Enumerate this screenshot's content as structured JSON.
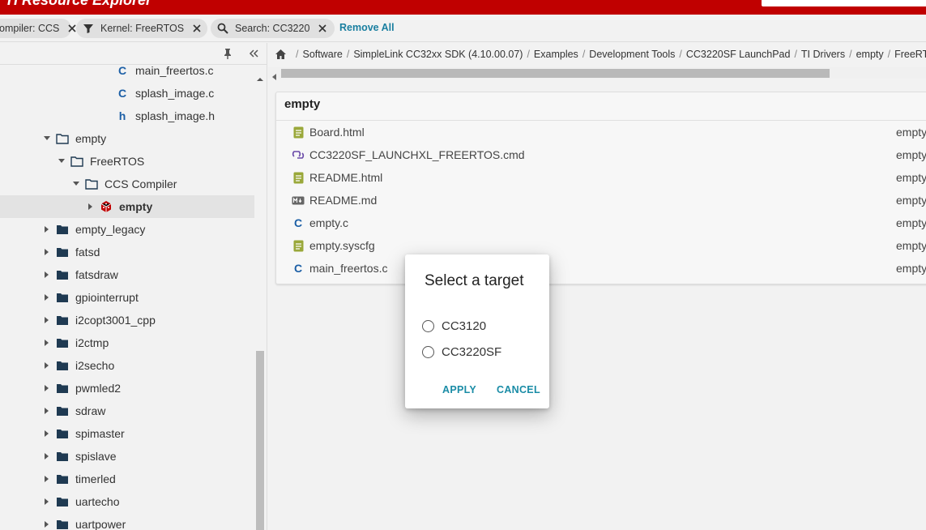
{
  "header": {
    "title": "TI Resource Explorer"
  },
  "filters": {
    "chips": [
      {
        "label": "Compiler: CCS",
        "icon": "funnel-icon"
      },
      {
        "label": "Kernel: FreeRTOS",
        "icon": "funnel-icon"
      },
      {
        "label": "Search: CC3220",
        "icon": "search-icon"
      }
    ],
    "remove_all": "Remove All"
  },
  "tree": {
    "items": [
      {
        "label": "main_freertos.c",
        "type": "c-file"
      },
      {
        "label": "splash_image.c",
        "type": "c-file"
      },
      {
        "label": "splash_image.h",
        "type": "h-file"
      },
      {
        "label": "empty",
        "type": "folder-open"
      },
      {
        "label": "FreeRTOS",
        "type": "folder-open"
      },
      {
        "label": "CCS Compiler",
        "type": "folder-open"
      },
      {
        "label": "empty",
        "type": "project"
      },
      {
        "label": "empty_legacy",
        "type": "folder"
      },
      {
        "label": "fatsd",
        "type": "folder"
      },
      {
        "label": "fatsdraw",
        "type": "folder"
      },
      {
        "label": "gpiointerrupt",
        "type": "folder"
      },
      {
        "label": "i2copt3001_cpp",
        "type": "folder"
      },
      {
        "label": "i2ctmp",
        "type": "folder"
      },
      {
        "label": "i2secho",
        "type": "folder"
      },
      {
        "label": "pwmled2",
        "type": "folder"
      },
      {
        "label": "sdraw",
        "type": "folder"
      },
      {
        "label": "spimaster",
        "type": "folder"
      },
      {
        "label": "spislave",
        "type": "folder"
      },
      {
        "label": "timerled",
        "type": "folder"
      },
      {
        "label": "uartecho",
        "type": "folder"
      },
      {
        "label": "uartpower",
        "type": "folder"
      }
    ]
  },
  "breadcrumb": {
    "items": [
      "Software",
      "SimpleLink CC32xx SDK (4.10.00.07)",
      "Examples",
      "Development Tools",
      "CC3220SF LaunchPad",
      "TI Drivers",
      "empty",
      "FreeRTOS"
    ]
  },
  "card": {
    "title": "empty",
    "files": [
      {
        "name": "Board.html",
        "desc": "empty",
        "icon": "document-icon"
      },
      {
        "name": "CC3220SF_LAUNCHXL_FREERTOS.cmd",
        "desc": "empty",
        "icon": "link-icon"
      },
      {
        "name": "README.html",
        "desc": "empty",
        "icon": "document-icon"
      },
      {
        "name": "README.md",
        "desc": "empty",
        "icon": "markdown-icon"
      },
      {
        "name": "empty.c",
        "desc": "empty",
        "icon": "c-file-icon"
      },
      {
        "name": "empty.syscfg",
        "desc": "empty",
        "icon": "document-icon"
      },
      {
        "name": "main_freertos.c",
        "desc": "empty",
        "icon": "c-file-icon"
      }
    ]
  },
  "dialog": {
    "title": "Select a target",
    "options": [
      "CC3120",
      "CC3220SF"
    ],
    "apply": "APPLY",
    "cancel": "CANCEL"
  },
  "colors": {
    "brand": "#c00000",
    "accent": "#1a8ca6",
    "folder": "#1f3a52",
    "c_file": "#1c5fa6",
    "doc": "#9aa83a"
  }
}
